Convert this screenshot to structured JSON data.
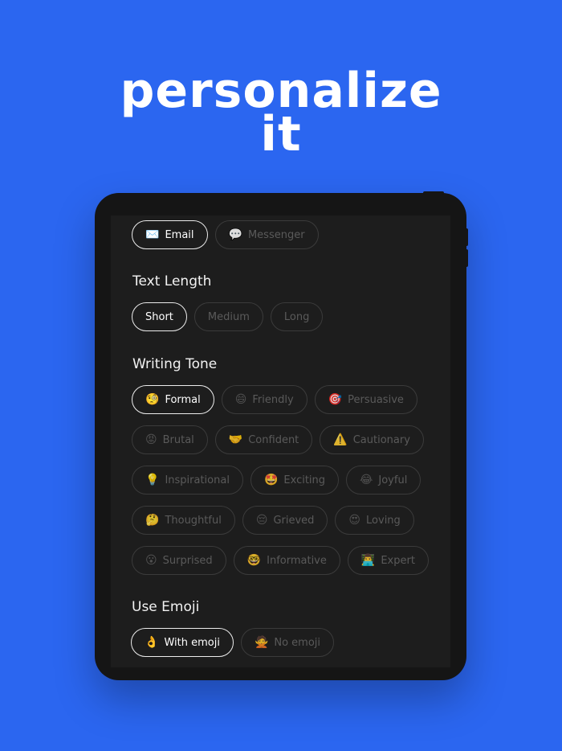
{
  "headline": {
    "line1": "personalize",
    "line2": "it"
  },
  "channels": [
    {
      "label": "Email",
      "icon": "✉️",
      "selected": true
    },
    {
      "label": "Messenger",
      "icon": "💬",
      "selected": false
    }
  ],
  "text_length": {
    "title": "Text Length",
    "options": [
      {
        "label": "Short",
        "selected": true
      },
      {
        "label": "Medium",
        "selected": false
      },
      {
        "label": "Long",
        "selected": false
      }
    ]
  },
  "writing_tone": {
    "title": "Writing Tone",
    "rows": [
      [
        {
          "label": "Formal",
          "icon": "🧐",
          "selected": true
        },
        {
          "label": "Friendly",
          "icon": "😄",
          "selected": false
        },
        {
          "label": "Persuasive",
          "icon": "🎯",
          "selected": false
        }
      ],
      [
        {
          "label": "Brutal",
          "icon": "😡",
          "selected": false
        },
        {
          "label": "Confident",
          "icon": "🤝",
          "selected": false
        },
        {
          "label": "Cautionary",
          "icon": "⚠️",
          "selected": false
        }
      ],
      [
        {
          "label": "Inspirational",
          "icon": "💡",
          "selected": false
        },
        {
          "label": "Exciting",
          "icon": "🤩",
          "selected": false
        },
        {
          "label": "Joyful",
          "icon": "😂",
          "selected": false
        }
      ],
      [
        {
          "label": "Thoughtful",
          "icon": "🤔",
          "selected": false
        },
        {
          "label": "Grieved",
          "icon": "😔",
          "selected": false
        },
        {
          "label": "Loving",
          "icon": "😍",
          "selected": false
        }
      ],
      [
        {
          "label": "Surprised",
          "icon": "😮",
          "selected": false
        },
        {
          "label": "Informative",
          "icon": "🤓",
          "selected": false
        },
        {
          "label": "Expert",
          "icon": "👨‍💻",
          "selected": false
        }
      ]
    ]
  },
  "use_emoji": {
    "title": "Use Emoji",
    "options": [
      {
        "label": "With emoji",
        "icon": "👌",
        "selected": true
      },
      {
        "label": "No emoji",
        "icon": "🙅",
        "selected": false
      }
    ]
  },
  "colors": {
    "background": "#2B66F0",
    "device": "#151515",
    "screen": "#1D1D1D",
    "chip_border": "#3B3B3B",
    "chip_selected_border": "#ECECEC"
  }
}
